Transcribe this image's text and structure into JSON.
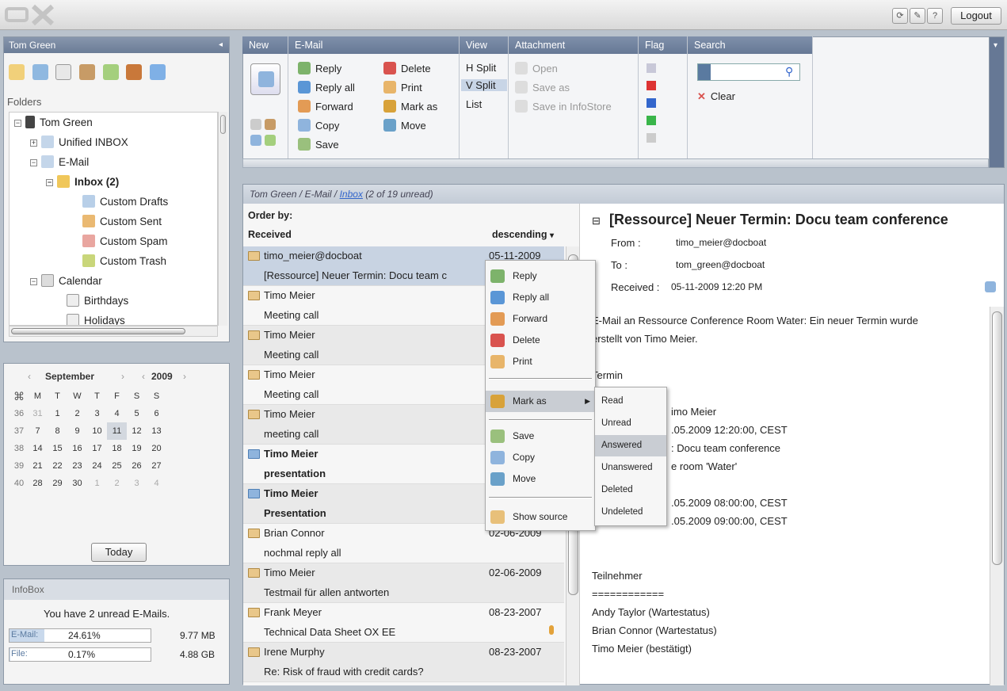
{
  "app": {
    "logout": "Logout"
  },
  "sidebar": {
    "user": "Tom Green",
    "collapse": "◂",
    "folders_label": "Folders",
    "tree": [
      {
        "label": "Tom Green",
        "level": 0
      },
      {
        "label": "Unified INBOX",
        "level": 1
      },
      {
        "label": "E-Mail",
        "level": 1
      },
      {
        "label": "Inbox (2)",
        "level": 2
      },
      {
        "label": "Custom Drafts",
        "level": 3
      },
      {
        "label": "Custom Sent",
        "level": 3
      },
      {
        "label": "Custom Spam",
        "level": 3
      },
      {
        "label": "Custom Trash",
        "level": 3
      },
      {
        "label": "Calendar",
        "level": 1
      },
      {
        "label": "Birthdays",
        "level": 2
      },
      {
        "label": "Holidays",
        "level": 2
      }
    ]
  },
  "minical": {
    "month": "September",
    "year": "2009",
    "weekdays": [
      "M",
      "T",
      "W",
      "T",
      "F",
      "S",
      "S"
    ],
    "weeks": [
      {
        "kw": "36",
        "days": [
          "31",
          "1",
          "2",
          "3",
          "4",
          "5",
          "6"
        ]
      },
      {
        "kw": "37",
        "days": [
          "7",
          "8",
          "9",
          "10",
          "11",
          "12",
          "13"
        ]
      },
      {
        "kw": "38",
        "days": [
          "14",
          "15",
          "16",
          "17",
          "18",
          "19",
          "20"
        ]
      },
      {
        "kw": "39",
        "days": [
          "21",
          "22",
          "23",
          "24",
          "25",
          "26",
          "27"
        ]
      },
      {
        "kw": "40",
        "days": [
          "28",
          "29",
          "30",
          "1",
          "2",
          "3",
          "4"
        ]
      }
    ],
    "today_label": "Today"
  },
  "infobox": {
    "title": "InfoBox",
    "unread_msg": "You have 2 unread E-Mails.",
    "email_label": "E-Mail:",
    "email_percent": "24.61%",
    "email_fill": 0.2461,
    "email_size": "9.77 MB",
    "file_label": "File:",
    "file_percent": "0.17%",
    "file_fill": 0.0017,
    "file_size": "4.88 GB"
  },
  "ribbon": {
    "new": {
      "title": "New"
    },
    "email": {
      "title": "E-Mail",
      "reply": "Reply",
      "reply_all": "Reply all",
      "forward": "Forward",
      "copy": "Copy",
      "save": "Save",
      "delete": "Delete",
      "print": "Print",
      "mark_as": "Mark as",
      "move": "Move"
    },
    "view": {
      "title": "View",
      "hsplit": "H Split",
      "vsplit": "V Split",
      "list": "List"
    },
    "attachment": {
      "title": "Attachment",
      "open": "Open",
      "save_as": "Save as",
      "save_infostore": "Save in InfoStore"
    },
    "flag": {
      "title": "Flag"
    },
    "search": {
      "title": "Search",
      "clear": "Clear",
      "value": ""
    }
  },
  "mail": {
    "breadcrumb_prefix": "Tom Green / E-Mail / ",
    "breadcrumb_link": "Inbox",
    "breadcrumb_suffix": " (2 of 19 unread)",
    "order_by": "Order by:",
    "sort_field": "Received",
    "sort_dir": "descending",
    "rows": [
      {
        "from": "timo_meier@docboat",
        "subject": "[Ressource] Neuer Termin: Docu team c",
        "date": "05-11-2009",
        "unread": false
      },
      {
        "from": "Timo Meier",
        "subject": "Meeting call",
        "date": "",
        "unread": false
      },
      {
        "from": "Timo Meier",
        "subject": "Meeting call",
        "date": "",
        "unread": false
      },
      {
        "from": "Timo Meier",
        "subject": "Meeting call",
        "date": "",
        "unread": false
      },
      {
        "from": "Timo Meier",
        "subject": "meeting call",
        "date": "",
        "unread": false
      },
      {
        "from": "Timo Meier",
        "subject": "presentation",
        "date": "",
        "unread": true
      },
      {
        "from": "Timo Meier",
        "subject": "Presentation",
        "date": "",
        "unread": true
      },
      {
        "from": "Brian Connor",
        "subject": "nochmal reply all",
        "date": "02-06-2009",
        "unread": false
      },
      {
        "from": "Timo Meier",
        "subject": "Testmail für allen antworten",
        "date": "02-06-2009",
        "unread": false
      },
      {
        "from": "Frank Meyer",
        "subject": "Technical Data Sheet OX EE",
        "date": "08-23-2007",
        "unread": false
      },
      {
        "from": "Irene Murphy",
        "subject": "Re: Risk of fraud with credit cards?",
        "date": "08-23-2007",
        "unread": false
      }
    ]
  },
  "context_menu": {
    "items": [
      "Reply",
      "Reply all",
      "Forward",
      "Delete",
      "Print",
      "Mark as",
      "Save",
      "Copy",
      "Move",
      "Show source"
    ],
    "submenu": [
      "Read",
      "Unread",
      "Answered",
      "Unanswered",
      "Deleted",
      "Undeleted"
    ]
  },
  "detail": {
    "subject": "[Ressource] Neuer Termin: Docu team conference",
    "from_label": "From :",
    "from": "timo_meier@docboat",
    "to_label": "To :",
    "to": "tom_green@docboat",
    "received_label": "Received :",
    "received": "05-11-2009 12:20 PM",
    "body": [
      "E-Mail an Ressource Conference Room Water: Ein neuer Termin wurde",
      "erstellt von Timo Meier.",
      "",
      "Termin",
      "",
      "imo Meier",
      ".05.2009 12:20:00, CEST",
      ": Docu team conference",
      "e room 'Water'",
      "",
      ".05.2009 08:00:00, CEST",
      ".05.2009 09:00:00, CEST",
      "",
      "",
      "Teilnehmer",
      "============",
      "Andy Taylor (Wartestatus)",
      "Brian Connor (Wartestatus)",
      "Timo Meier (bestätigt)"
    ]
  }
}
